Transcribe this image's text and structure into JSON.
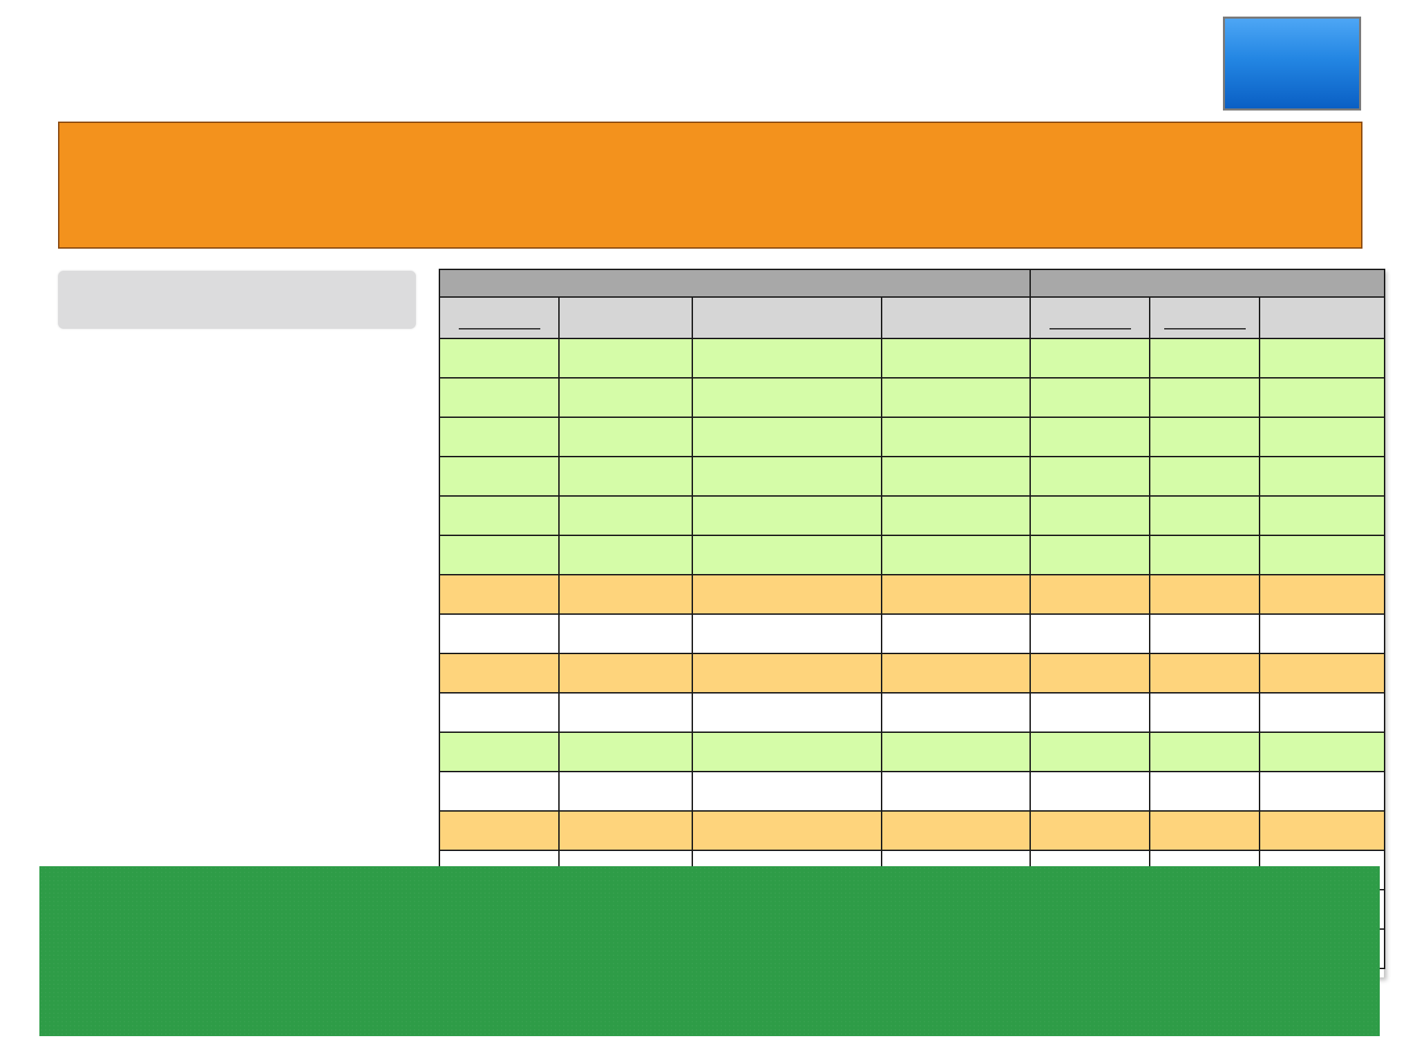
{
  "colors": {
    "accent_button": "#1f7fe0",
    "banner_top": "#f3921d",
    "banner_bottom": "#2e9c47",
    "label_box": "#dcdcdd",
    "table_group_header": "#a8a8a8",
    "table_column_header": "#d6d6d6",
    "row_green": "#d5fca8",
    "row_orange": "#fed47c",
    "row_white": "#ffffff"
  },
  "table": {
    "group_headers": [
      "",
      ""
    ],
    "column_headers": [
      "",
      "",
      "",
      "",
      "",
      "",
      ""
    ],
    "underlined_columns": [
      0,
      4,
      5
    ],
    "row_colors": [
      "green",
      "green",
      "green",
      "green",
      "green",
      "green",
      "orange",
      "white",
      "orange",
      "white",
      "green",
      "white",
      "orange",
      "white",
      "white",
      "white"
    ]
  }
}
